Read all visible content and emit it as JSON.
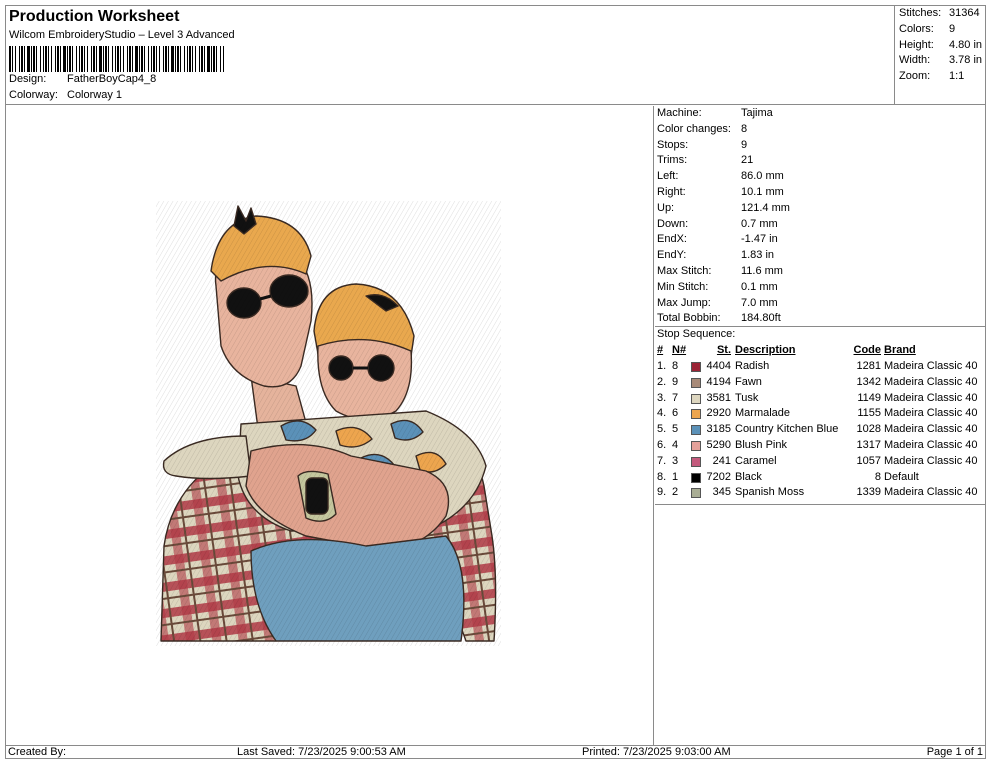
{
  "header": {
    "title": "Production Worksheet",
    "software": "Wilcom EmbroideryStudio – Level 3 Advanced",
    "design_label": "Design:",
    "design_value": "FatherBoyCap4_8",
    "colorway_label": "Colorway:",
    "colorway_value": "Colorway 1"
  },
  "summary": [
    {
      "label": "Stitches:",
      "value": "31364"
    },
    {
      "label": "Colors:",
      "value": "9"
    },
    {
      "label": "Height:",
      "value": "4.80 in"
    },
    {
      "label": "Width:",
      "value": "3.78 in"
    },
    {
      "label": "Zoom:",
      "value": "1:1"
    }
  ],
  "machine_info": [
    {
      "label": "Machine:",
      "value": "Tajima"
    },
    {
      "label": "Color changes:",
      "value": "8"
    },
    {
      "label": "Stops:",
      "value": "9"
    },
    {
      "label": "Trims:",
      "value": "21"
    },
    {
      "label": "Left:",
      "value": "86.0 mm"
    },
    {
      "label": "Right:",
      "value": "10.1 mm"
    },
    {
      "label": "Up:",
      "value": "121.4 mm"
    },
    {
      "label": "Down:",
      "value": "0.7 mm"
    },
    {
      "label": "EndX:",
      "value": "-1.47 in"
    },
    {
      "label": "EndY:",
      "value": "1.83 in"
    },
    {
      "label": "Max Stitch:",
      "value": "11.6 mm"
    },
    {
      "label": "Min Stitch:",
      "value": "0.1 mm"
    },
    {
      "label": "Max Jump:",
      "value": "7.0 mm"
    },
    {
      "label": "Total Bobbin:",
      "value": "184.80ft"
    }
  ],
  "stop_sequence": {
    "title": "Stop Sequence:",
    "headers": {
      "num": "#",
      "n": "N#",
      "st": "St.",
      "desc": "Description",
      "code": "Code",
      "brand": "Brand"
    },
    "rows": [
      {
        "num": "1.",
        "n": "8",
        "color": "#9b2335",
        "st": "4404",
        "desc": "Radish",
        "code": "1281",
        "brand": "Madeira Classic 40"
      },
      {
        "num": "2.",
        "n": "9",
        "color": "#a88a78",
        "st": "4194",
        "desc": "Fawn",
        "code": "1342",
        "brand": "Madeira Classic 40"
      },
      {
        "num": "3.",
        "n": "7",
        "color": "#ddd6bf",
        "st": "3581",
        "desc": "Tusk",
        "code": "1149",
        "brand": "Madeira Classic 40"
      },
      {
        "num": "4.",
        "n": "6",
        "color": "#eda54e",
        "st": "2920",
        "desc": "Marmalade",
        "code": "1155",
        "brand": "Madeira Classic 40"
      },
      {
        "num": "5.",
        "n": "5",
        "color": "#5b91b8",
        "st": "3185",
        "desc": "Country Kitchen Blue",
        "code": "1028",
        "brand": "Madeira Classic 40"
      },
      {
        "num": "6.",
        "n": "4",
        "color": "#e4a19a",
        "st": "5290",
        "desc": "Blush Pink",
        "code": "1317",
        "brand": "Madeira Classic 40"
      },
      {
        "num": "7.",
        "n": "3",
        "color": "#c45a7d",
        "st": "241",
        "desc": "Caramel",
        "code": "1057",
        "brand": "Madeira Classic 40"
      },
      {
        "num": "8.",
        "n": "1",
        "color": "#000000",
        "st": "7202",
        "desc": "Black",
        "code": "8",
        "brand": "Default"
      },
      {
        "num": "9.",
        "n": "2",
        "color": "#a9ad94",
        "st": "345",
        "desc": "Spanish Moss",
        "code": "1339",
        "brand": "Madeira Classic 40"
      }
    ]
  },
  "footer": {
    "created_by": "Created By:",
    "last_saved": "Last Saved: 7/23/2025 9:00:53 AM",
    "printed": "Printed: 7/23/2025 9:03:00 AM",
    "page": "Page 1 of 1"
  }
}
